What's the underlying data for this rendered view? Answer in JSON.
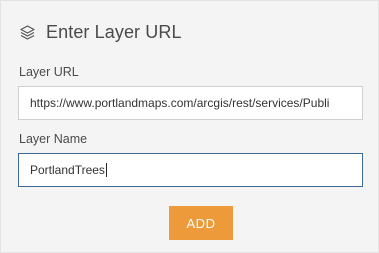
{
  "header": {
    "icon": "layers-icon",
    "title": "Enter Layer URL"
  },
  "form": {
    "url_label": "Layer URL",
    "url_value": "https://www.portlandmaps.com/arcgis/rest/services/Publi",
    "name_label": "Layer Name",
    "name_value": "PortlandTrees",
    "add_label": "ADD"
  },
  "colors": {
    "accent_button": "#ec9a3a",
    "focused_border": "#3c6a95"
  }
}
